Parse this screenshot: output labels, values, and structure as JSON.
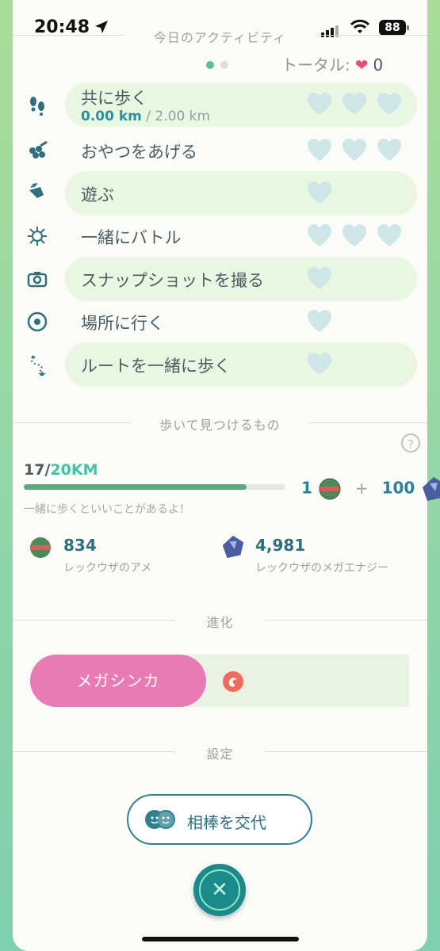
{
  "status": {
    "time": "20:48",
    "battery": "88"
  },
  "activity": {
    "title": "今日のアクティビティ",
    "total_label": "トータル:",
    "total_value": "0",
    "rows": [
      {
        "label": "共に歩く",
        "hearts": 3,
        "icon": "footprints-icon"
      },
      {
        "label": "おやつをあげる",
        "hearts": 3,
        "icon": "berries-icon"
      },
      {
        "label": "遊ぶ",
        "hearts": 1,
        "icon": "wave-hand-icon"
      },
      {
        "label": "一緒にバトル",
        "hearts": 3,
        "icon": "battle-icon"
      },
      {
        "label": "スナップショットを撮る",
        "hearts": 1,
        "icon": "camera-icon"
      },
      {
        "label": "場所に行く",
        "hearts": 1,
        "icon": "pokestop-icon"
      },
      {
        "label": "ルートを一緒に歩く",
        "hearts": 1,
        "icon": "route-icon"
      }
    ],
    "walk_current": "0.00 km",
    "walk_goal": "/ 2.00 km"
  },
  "walk": {
    "title": "歩いて見つけるもの",
    "progress_current": "17",
    "progress_sep": "/",
    "progress_goal": "20KM",
    "progress_fraction": 0.85,
    "reward_candy": "1",
    "reward_plus": "+",
    "reward_energy": "100",
    "hint": "一緒に歩くといいことがあるよ！"
  },
  "resources": {
    "candy_count": "834",
    "candy_name": "レックウザのアメ",
    "energy_count": "4,981",
    "energy_name": "レックウザのメガエナジー"
  },
  "evolution": {
    "title": "進化",
    "mega_label": "メガシンカ"
  },
  "settings": {
    "title": "設定",
    "swap_label": "相棒を交代"
  },
  "colors": {
    "accent": "#2f7f90",
    "heart_empty": "#cfe6e8",
    "mega_pink": "#e97bb4",
    "highlight_row": "#e9f6e1"
  }
}
